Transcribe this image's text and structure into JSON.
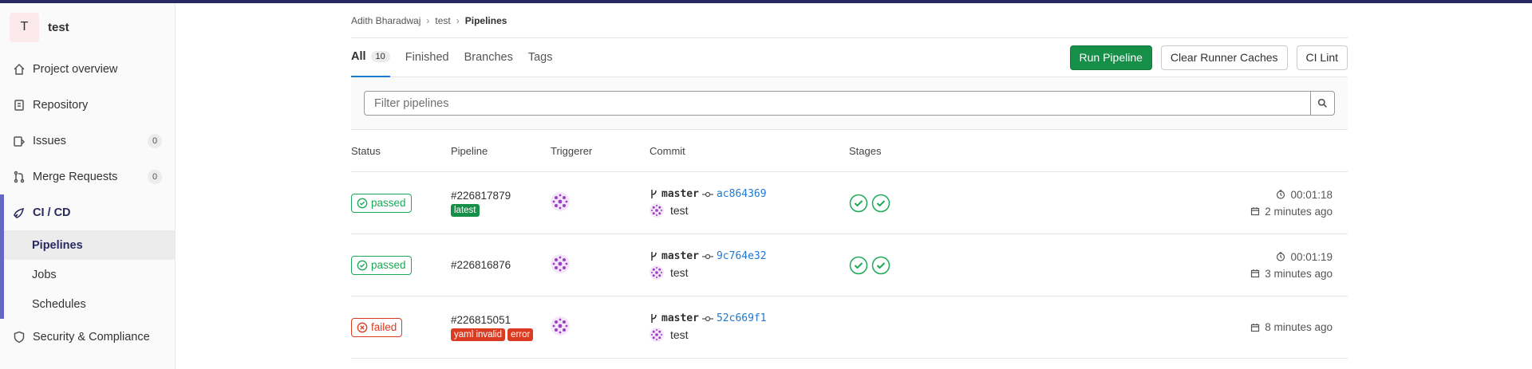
{
  "project": {
    "initial": "T",
    "name": "test"
  },
  "sidebar": {
    "items": [
      {
        "label": "Project overview",
        "icon": "home-icon"
      },
      {
        "label": "Repository",
        "icon": "doc-icon"
      },
      {
        "label": "Issues",
        "icon": "issues-icon",
        "count": "0"
      },
      {
        "label": "Merge Requests",
        "icon": "merge-icon",
        "count": "0"
      }
    ],
    "cicd": {
      "label": "CI / CD",
      "icon": "rocket-icon",
      "sub": [
        "Pipelines",
        "Jobs",
        "Schedules"
      ]
    },
    "security": {
      "label": "Security & Compliance",
      "icon": "shield-icon"
    }
  },
  "breadcrumb": [
    "Adith Bharadwaj",
    "test",
    "Pipelines"
  ],
  "tabs": [
    {
      "label": "All",
      "count": "10"
    },
    {
      "label": "Finished"
    },
    {
      "label": "Branches"
    },
    {
      "label": "Tags"
    }
  ],
  "actions": {
    "run": "Run Pipeline",
    "clear": "Clear Runner Caches",
    "lint": "CI Lint"
  },
  "filter": {
    "placeholder": "Filter pipelines"
  },
  "table": {
    "headers": [
      "Status",
      "Pipeline",
      "Triggerer",
      "Commit",
      "Stages"
    ],
    "rows": [
      {
        "status": "passed",
        "id": "#226817879",
        "labels": [
          "latest"
        ],
        "branch": "master",
        "sha": "ac864369",
        "message": "test",
        "stages": 2,
        "duration": "00:01:18",
        "ago": "2 minutes ago"
      },
      {
        "status": "passed",
        "id": "#226816876",
        "labels": [],
        "branch": "master",
        "sha": "9c764e32",
        "message": "test",
        "stages": 2,
        "duration": "00:01:19",
        "ago": "3 minutes ago"
      },
      {
        "status": "failed",
        "id": "#226815051",
        "labels": [
          "yaml invalid",
          "error"
        ],
        "branch": "master",
        "sha": "52c669f1",
        "message": "test",
        "stages": 0,
        "duration": "",
        "ago": "8 minutes ago"
      }
    ]
  },
  "colors": {
    "passed": "#1aaa55",
    "failed": "#db3b21",
    "link": "#1f78d1",
    "nav_accent": "#292961"
  }
}
